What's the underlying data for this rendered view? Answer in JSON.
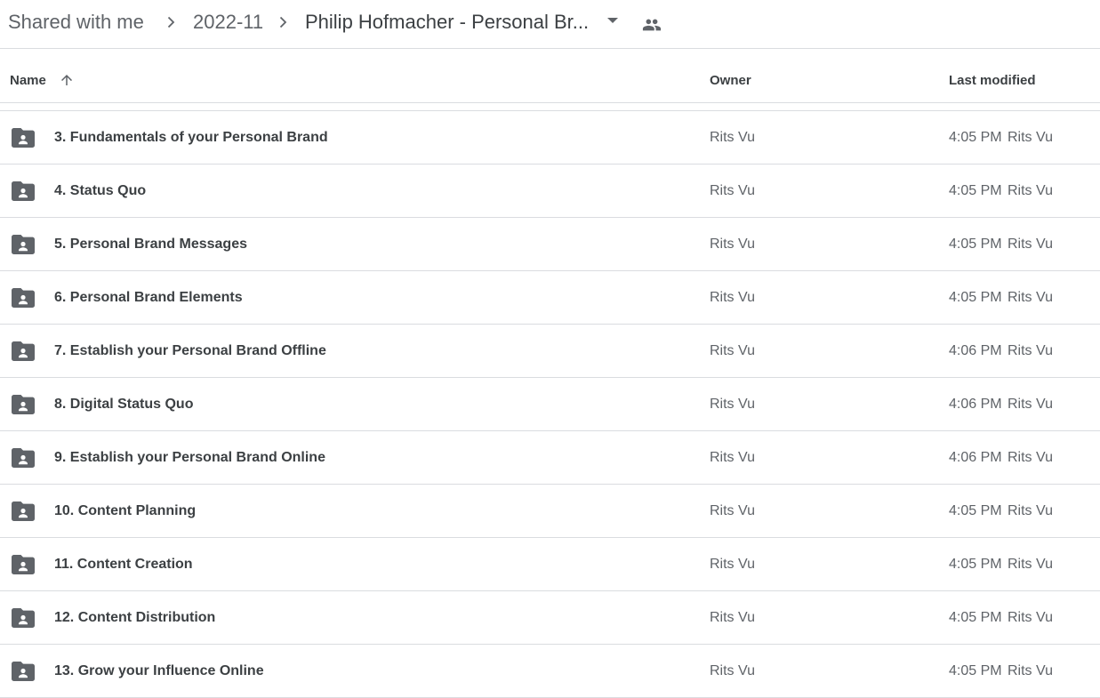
{
  "breadcrumb": {
    "items": [
      {
        "label": "Shared with me"
      },
      {
        "label": "2022-11"
      },
      {
        "label": "Philip Hofmacher - Personal Br..."
      }
    ],
    "chevron_icon": "chevron-right-icon",
    "dropdown_icon": "caret-down-icon",
    "shared_icon": "people-icon"
  },
  "columns": {
    "name": "Name",
    "owner": "Owner",
    "last_modified": "Last modified",
    "sort_icon": "arrow-up-icon"
  },
  "colors": {
    "folder": "#5f6368",
    "divider": "#dadce0",
    "text": "#3c4043",
    "muted": "#5f6368"
  },
  "rows": [
    {
      "name": "3. Fundamentals of your Personal Brand",
      "owner": "Rits Vu",
      "modified": "4:05 PM",
      "modifier": "Rits Vu",
      "icon": "shared-folder-icon"
    },
    {
      "name": "4. Status Quo",
      "owner": "Rits Vu",
      "modified": "4:05 PM",
      "modifier": "Rits Vu",
      "icon": "shared-folder-icon"
    },
    {
      "name": "5. Personal Brand Messages",
      "owner": "Rits Vu",
      "modified": "4:05 PM",
      "modifier": "Rits Vu",
      "icon": "shared-folder-icon"
    },
    {
      "name": "6. Personal Brand Elements",
      "owner": "Rits Vu",
      "modified": "4:05 PM",
      "modifier": "Rits Vu",
      "icon": "shared-folder-icon"
    },
    {
      "name": "7. Establish your Personal Brand Offline",
      "owner": "Rits Vu",
      "modified": "4:06 PM",
      "modifier": "Rits Vu",
      "icon": "shared-folder-icon"
    },
    {
      "name": "8. Digital Status Quo",
      "owner": "Rits Vu",
      "modified": "4:06 PM",
      "modifier": "Rits Vu",
      "icon": "shared-folder-icon"
    },
    {
      "name": "9. Establish your Personal Brand Online",
      "owner": "Rits Vu",
      "modified": "4:06 PM",
      "modifier": "Rits Vu",
      "icon": "shared-folder-icon"
    },
    {
      "name": "10. Content Planning",
      "owner": "Rits Vu",
      "modified": "4:05 PM",
      "modifier": "Rits Vu",
      "icon": "shared-folder-icon"
    },
    {
      "name": "11. Content Creation",
      "owner": "Rits Vu",
      "modified": "4:05 PM",
      "modifier": "Rits Vu",
      "icon": "shared-folder-icon"
    },
    {
      "name": "12. Content Distribution",
      "owner": "Rits Vu",
      "modified": "4:05 PM",
      "modifier": "Rits Vu",
      "icon": "shared-folder-icon"
    },
    {
      "name": "13. Grow your Influence Online",
      "owner": "Rits Vu",
      "modified": "4:05 PM",
      "modifier": "Rits Vu",
      "icon": "shared-folder-icon"
    }
  ]
}
